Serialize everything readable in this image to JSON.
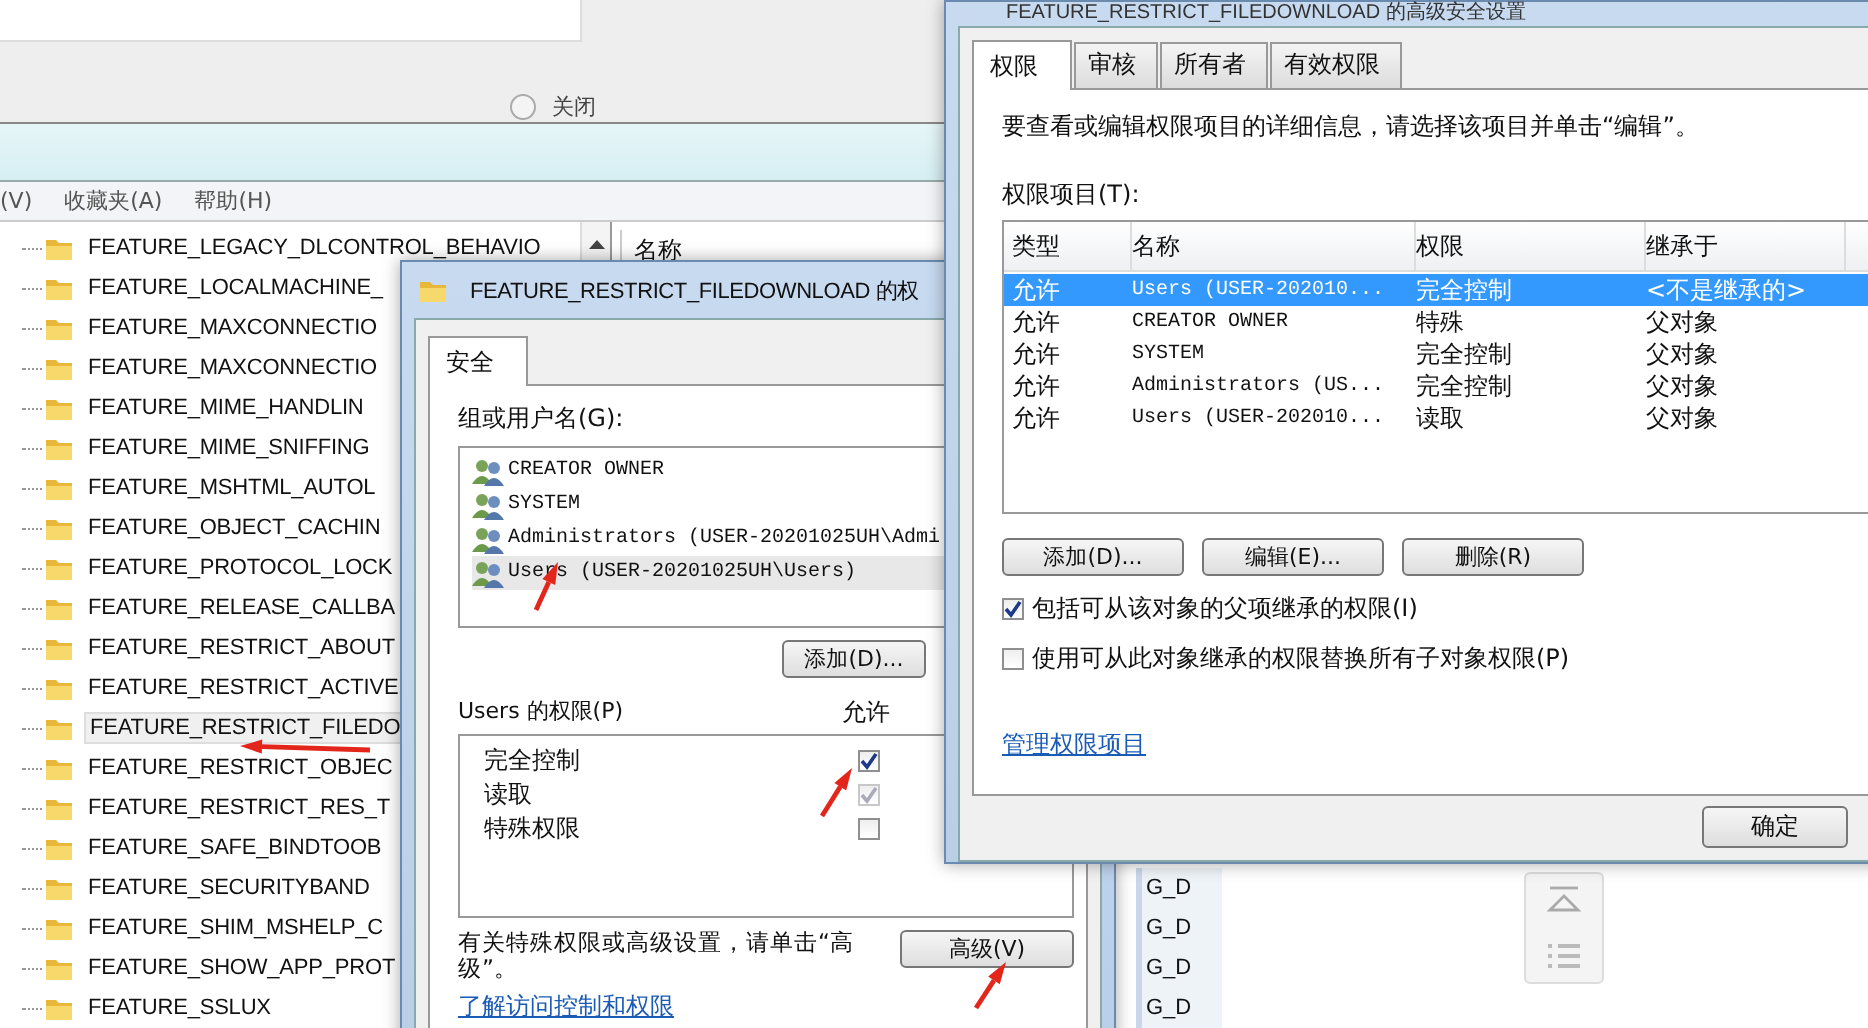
{
  "background_window": {
    "radio_selected": false,
    "radio_label": "关闭",
    "menu": [
      "(V)",
      "收藏夹(A)",
      "帮助(H)"
    ],
    "tree": [
      {
        "label": "FEATURE_LEGACY_DLCONTROL_BEHAVIO",
        "selected": false
      },
      {
        "label": "FEATURE_LOCALMACHINE_",
        "selected": false
      },
      {
        "label": "FEATURE_MAXCONNECTIO",
        "selected": false
      },
      {
        "label": "FEATURE_MAXCONNECTIO",
        "selected": false
      },
      {
        "label": "FEATURE_MIME_HANDLIN",
        "selected": false
      },
      {
        "label": "FEATURE_MIME_SNIFFING",
        "selected": false
      },
      {
        "label": "FEATURE_MSHTML_AUTOL",
        "selected": false
      },
      {
        "label": "FEATURE_OBJECT_CACHIN",
        "selected": false
      },
      {
        "label": "FEATURE_PROTOCOL_LOCK",
        "selected": false
      },
      {
        "label": "FEATURE_RELEASE_CALLBA",
        "selected": false
      },
      {
        "label": "FEATURE_RESTRICT_ABOUT",
        "selected": false
      },
      {
        "label": "FEATURE_RESTRICT_ACTIVE",
        "selected": false
      },
      {
        "label": "FEATURE_RESTRICT_FILEDO",
        "selected": true
      },
      {
        "label": "FEATURE_RESTRICT_OBJEC",
        "selected": false
      },
      {
        "label": "FEATURE_RESTRICT_RES_T",
        "selected": false
      },
      {
        "label": "FEATURE_SAFE_BINDTOOB",
        "selected": false
      },
      {
        "label": "FEATURE_SECURITYBAND",
        "selected": false
      },
      {
        "label": "FEATURE_SHIM_MSHELP_C",
        "selected": false
      },
      {
        "label": "FEATURE_SHOW_APP_PROT",
        "selected": false
      },
      {
        "label": "FEATURE_SSLUX",
        "selected": false
      }
    ],
    "list_header": "名称",
    "list_cells": [
      "G_D",
      "G_D",
      "G_D",
      "G_D"
    ]
  },
  "properties_dialog": {
    "title": "FEATURE_RESTRICT_FILEDOWNLOAD 的权",
    "tabs": [
      {
        "label": "安全",
        "selected": true
      }
    ],
    "group_label": "组或用户名(G):",
    "principals": [
      {
        "name": "CREATOR OWNER",
        "selected": false
      },
      {
        "name": "SYSTEM",
        "selected": false
      },
      {
        "name": "Administrators (USER-20201025UH\\Admi",
        "selected": false
      },
      {
        "name": "Users (USER-20201025UH\\Users)",
        "selected": true
      }
    ],
    "add_button": "添加(D)...",
    "permissions_label": "Users 的权限(P)",
    "allow_header": "允许",
    "permissions": [
      {
        "name": "完全控制",
        "checked": true,
        "disabled": false
      },
      {
        "name": "读取",
        "checked": true,
        "disabled": true
      },
      {
        "name": "特殊权限",
        "checked": false,
        "disabled": false
      }
    ],
    "advanced_note": "有关特殊权限或高级设置，请单击“高级”。",
    "advanced_button": "高级(V)",
    "link": "了解访问控制和权限"
  },
  "advanced_dialog": {
    "title": "FEATURE_RESTRICT_FILEDOWNLOAD 的高级安全设置",
    "tabs": [
      {
        "label": "权限",
        "selected": true
      },
      {
        "label": "审核",
        "selected": false
      },
      {
        "label": "所有者",
        "selected": false
      },
      {
        "label": "有效权限",
        "selected": false
      }
    ],
    "instruction": "要查看或编辑权限项目的详细信息，请选择该项目并单击“编辑”。",
    "entries_label": "权限项目(T):",
    "columns": [
      "类型",
      "名称",
      "权限",
      "继承于"
    ],
    "rows": [
      {
        "type": "允许",
        "name": "Users (USER-202010...",
        "permission": "完全控制",
        "inherited_from": "<不是继承的>",
        "selected": true
      },
      {
        "type": "允许",
        "name": "CREATOR OWNER",
        "permission": "特殊",
        "inherited_from": "父对象",
        "selected": false
      },
      {
        "type": "允许",
        "name": "SYSTEM",
        "permission": "完全控制",
        "inherited_from": "父对象",
        "selected": false
      },
      {
        "type": "允许",
        "name": "Administrators (US...",
        "permission": "完全控制",
        "inherited_from": "父对象",
        "selected": false
      },
      {
        "type": "允许",
        "name": "Users (USER-202010...",
        "permission": "读取",
        "inherited_from": "父对象",
        "selected": false
      }
    ],
    "buttons": [
      "添加(D)...",
      "编辑(E)...",
      "删除(R)"
    ],
    "options": [
      {
        "label": "包括可从该对象的父项继承的权限(I)",
        "checked": true
      },
      {
        "label": "使用可从此对象继承的权限替换所有子对象权限(P)",
        "checked": false
      }
    ],
    "link": "管理权限项目",
    "ok_button": "确定"
  }
}
